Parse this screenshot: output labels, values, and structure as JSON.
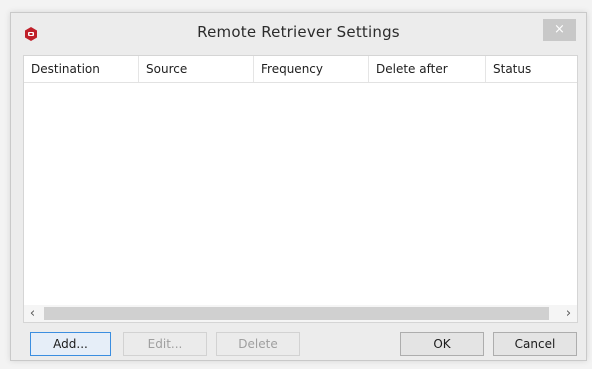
{
  "window": {
    "title": "Remote Retriever Settings",
    "close_glyph": "×",
    "icon": "app-logo-icon",
    "accent_color": "#c0202a"
  },
  "list": {
    "columns": [
      "Destination",
      "Source",
      "Frequency",
      "Delete after",
      "Status"
    ],
    "rows": []
  },
  "scrollbar": {
    "left_glyph": "‹",
    "right_glyph": "›"
  },
  "buttons": {
    "add_label": "Add...",
    "edit_label": "Edit...",
    "delete_label": "Delete",
    "ok_label": "OK",
    "cancel_label": "Cancel"
  }
}
